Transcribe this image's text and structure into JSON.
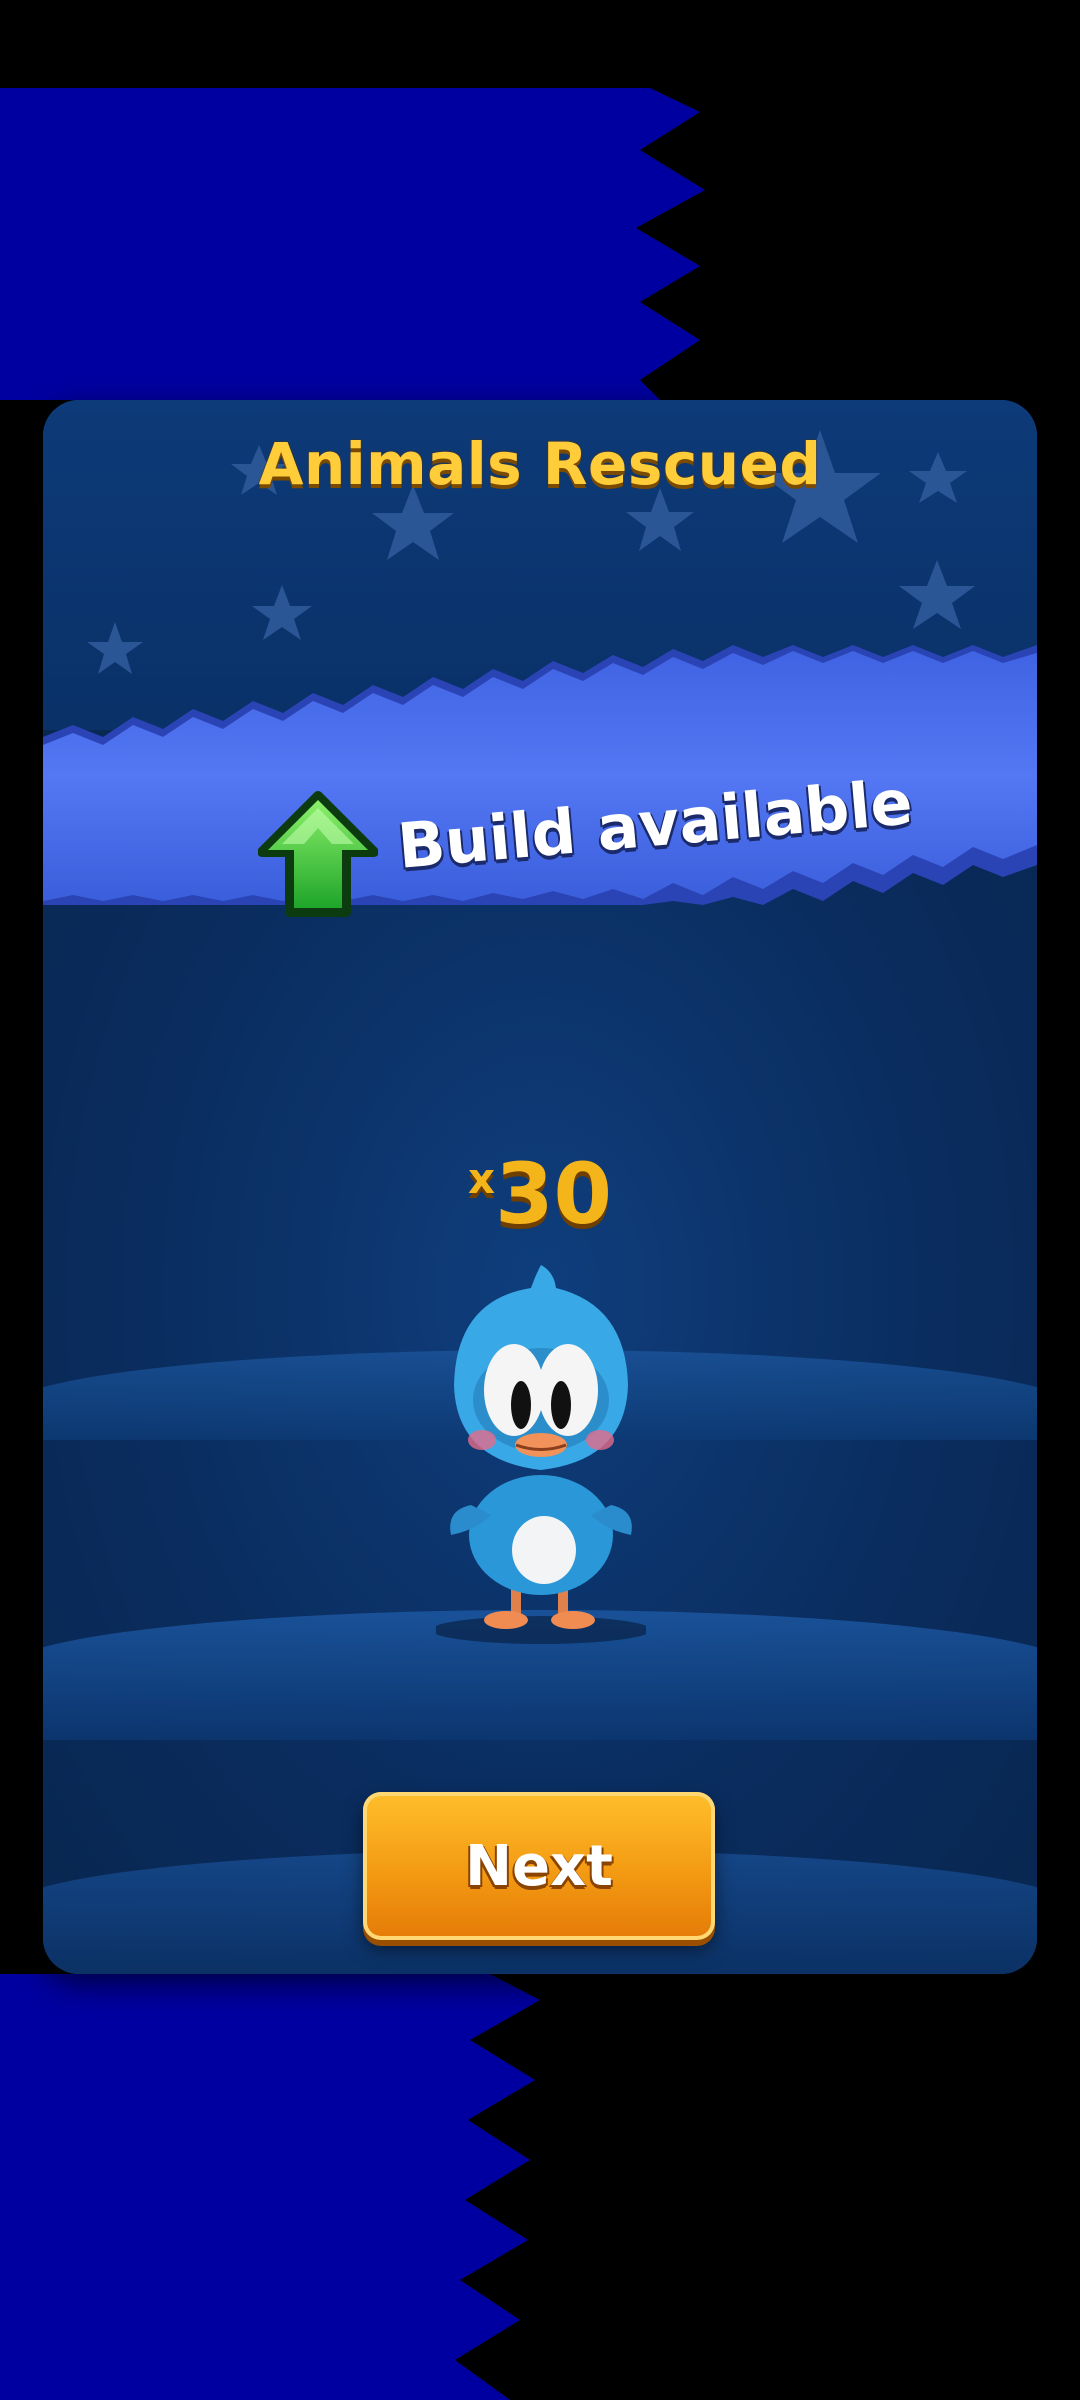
{
  "dialog": {
    "title": "Animals Rescued",
    "banner_text": "Build available",
    "count_prefix": "x",
    "count_value": "30",
    "next_label": "Next"
  },
  "icons": {
    "build": "green-up-arrow-icon",
    "animal": "blue-bird"
  },
  "colors": {
    "background_left": "#0000a0",
    "background_right": "#000000",
    "panel": "#0b2f63",
    "ribbon": "#4a70f0",
    "title": "#ffcd3a",
    "button": "#f39a12"
  }
}
